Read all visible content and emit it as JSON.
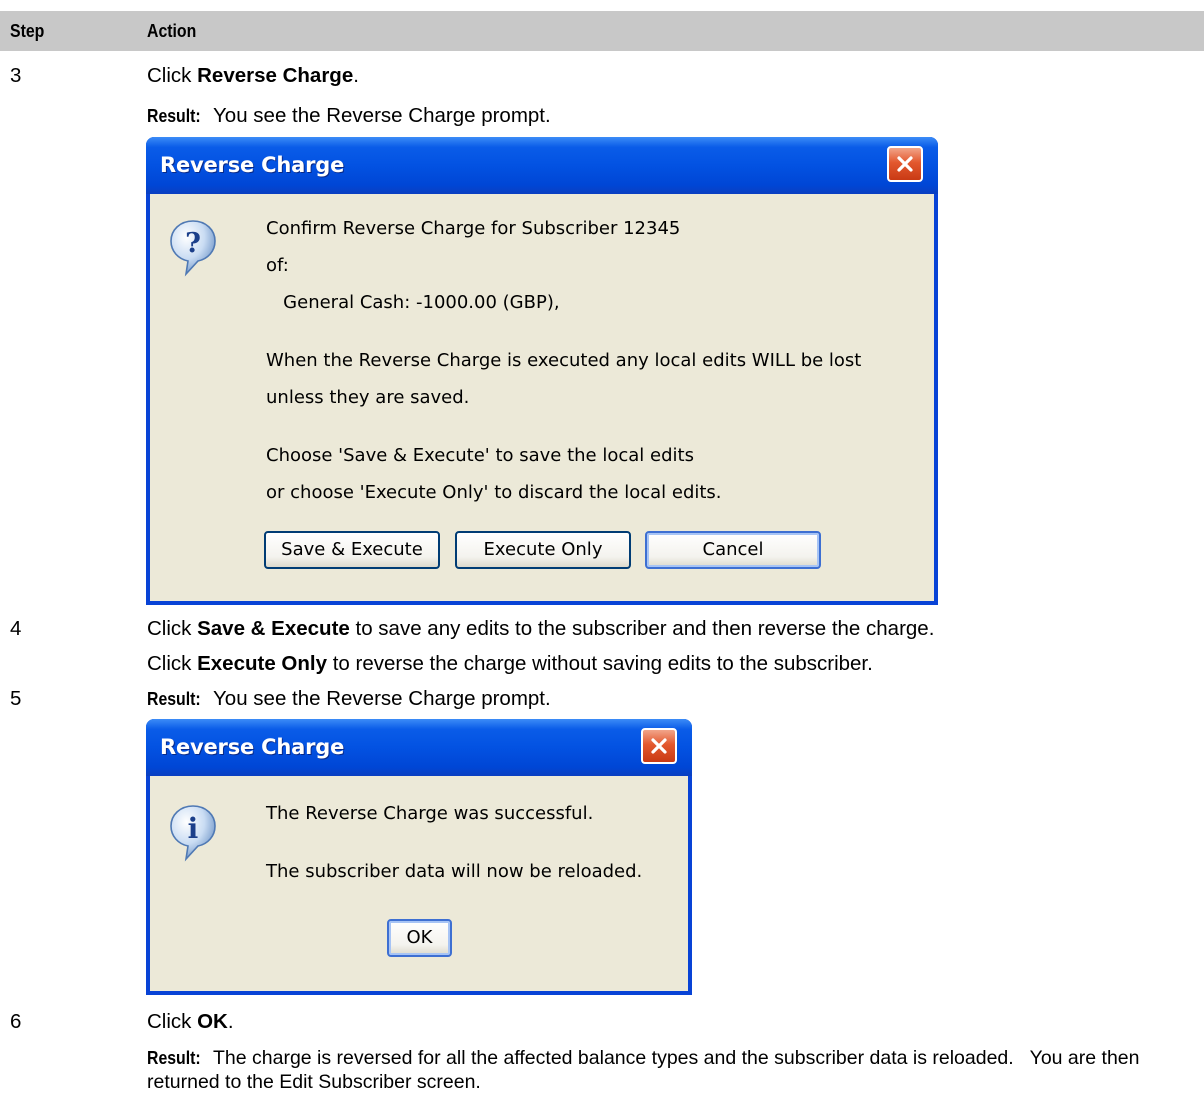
{
  "table": {
    "col_step": "Step",
    "col_action": "Action"
  },
  "rows": [
    {
      "step": "3",
      "text_pre": "Click ",
      "text_bold": "Reverse Charge",
      "text_post": ".",
      "result_label": "Result:",
      "result_text": "You see the Reverse Charge prompt."
    },
    {
      "step": "4",
      "line1_pre": "Click ",
      "line1_bold": "Save & Execute",
      "line1_post": " to save any edits to the subscriber and then reverse the charge.",
      "line2_pre": "Click ",
      "line2_bold": "Execute Only",
      "line2_post": " to reverse the charge without saving edits to the subscriber."
    },
    {
      "step": "5",
      "result_label": "Result:",
      "result_text": "You see the Reverse Charge prompt."
    },
    {
      "step": "6",
      "text_pre": "Click ",
      "text_bold": "OK",
      "text_post": ".",
      "result_label": "Result:",
      "result_text": "The charge is reversed for all the affected balance types and the subscriber data is reloaded.   You are then returned to the Edit Subscriber screen."
    }
  ],
  "dialog_confirm": {
    "title": "Reverse Charge",
    "icon": "question-icon",
    "lines": [
      "Confirm Reverse Charge for Subscriber 12345",
      "of:",
      "   General Cash: -1000.00 (GBP),",
      "When the Reverse Charge is executed any local edits WILL be lost",
      "unless they are saved.",
      "Choose 'Save & Execute' to save the local edits",
      "or choose 'Execute Only' to discard the local edits."
    ],
    "buttons": {
      "save_execute": "Save & Execute",
      "execute_only": "Execute Only",
      "cancel": "Cancel"
    }
  },
  "dialog_info": {
    "title": "Reverse Charge",
    "icon": "info-icon",
    "lines": [
      "The Reverse Charge was successful.",
      "The subscriber data will now be reloaded."
    ],
    "buttons": {
      "ok": "OK"
    }
  },
  "colors": {
    "header_bg": "#c8c8c8",
    "xp_title_blue": "#0352e2",
    "dialog_face": "#ece9d8",
    "close_red": "#e3582e"
  }
}
